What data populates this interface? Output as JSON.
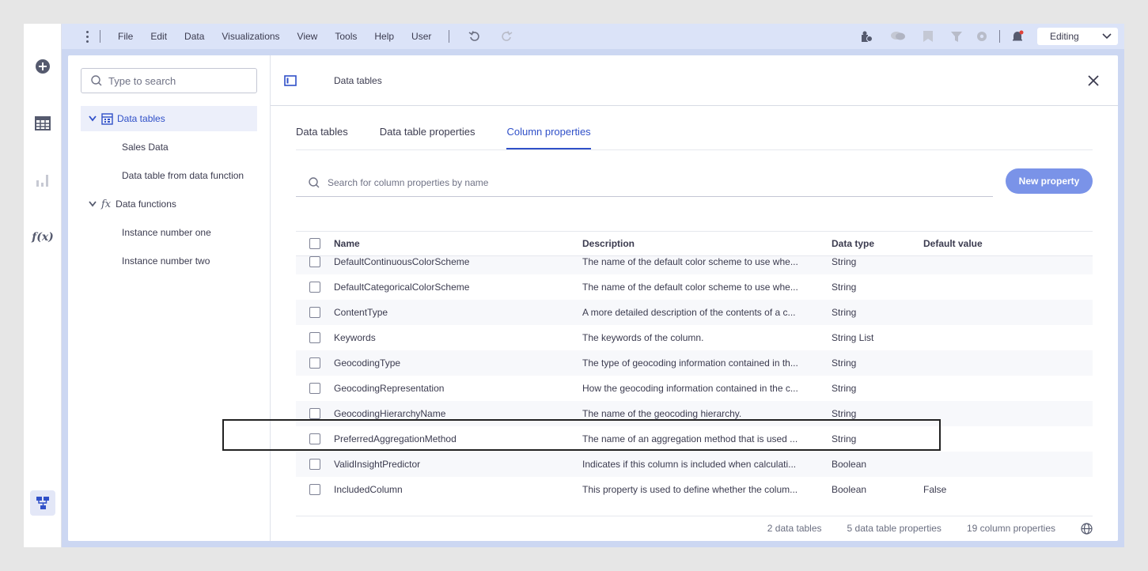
{
  "menubar": {
    "items": [
      "File",
      "Edit",
      "Data",
      "Visualizations",
      "View",
      "Tools",
      "Help",
      "User"
    ],
    "mode": "Editing"
  },
  "sidebar": {
    "search_placeholder": "Type to search",
    "tree": [
      {
        "label": "Data tables",
        "selected": true,
        "children": [
          "Sales Data",
          "Data table from data function"
        ]
      },
      {
        "label": "Data functions",
        "icon": "fx",
        "children": [
          "Instance number one",
          "Instance number two"
        ]
      }
    ]
  },
  "main": {
    "title": "Data tables",
    "tabs": [
      "Data tables",
      "Data table properties",
      "Column properties"
    ],
    "active_tab": "Column properties",
    "search_placeholder": "Search for column properties by name",
    "new_button": "New property"
  },
  "table": {
    "headers": [
      "Name",
      "Description",
      "Data type",
      "Default value"
    ],
    "rows": [
      {
        "name": "DefaultContinuousColorScheme",
        "description": "The name of the default color scheme to use whe...",
        "type": "String",
        "default": ""
      },
      {
        "name": "DefaultCategoricalColorScheme",
        "description": "The name of the default color scheme to use whe...",
        "type": "String",
        "default": ""
      },
      {
        "name": "ContentType",
        "description": "A more detailed description of the contents of a c...",
        "type": "String",
        "default": ""
      },
      {
        "name": "Keywords",
        "description": "The keywords of the column.",
        "type": "String List",
        "default": ""
      },
      {
        "name": "GeocodingType",
        "description": "The type of geocoding information contained in th...",
        "type": "String",
        "default": ""
      },
      {
        "name": "GeocodingRepresentation",
        "description": "How the geocoding information contained in the c...",
        "type": "String",
        "default": ""
      },
      {
        "name": "GeocodingHierarchyName",
        "description": "The name of the geocoding hierarchy.",
        "type": "String",
        "default": ""
      },
      {
        "name": "PreferredAggregationMethod",
        "description": "The name of an aggregation method that is used ...",
        "type": "String",
        "default": ""
      },
      {
        "name": "ValidInsightPredictor",
        "description": "Indicates if this column is included when calculati...",
        "type": "Boolean",
        "default": ""
      },
      {
        "name": "IncludedColumn",
        "description": "This property is used to define whether the colum...",
        "type": "Boolean",
        "default": "False"
      }
    ]
  },
  "footer": {
    "tables": "2 data tables",
    "table_props": "5 data table properties",
    "column_props": "19 column properties"
  },
  "colors": {
    "accent": "#3050c8",
    "button": "#7a93e8",
    "frame": "#ccd7f2"
  }
}
